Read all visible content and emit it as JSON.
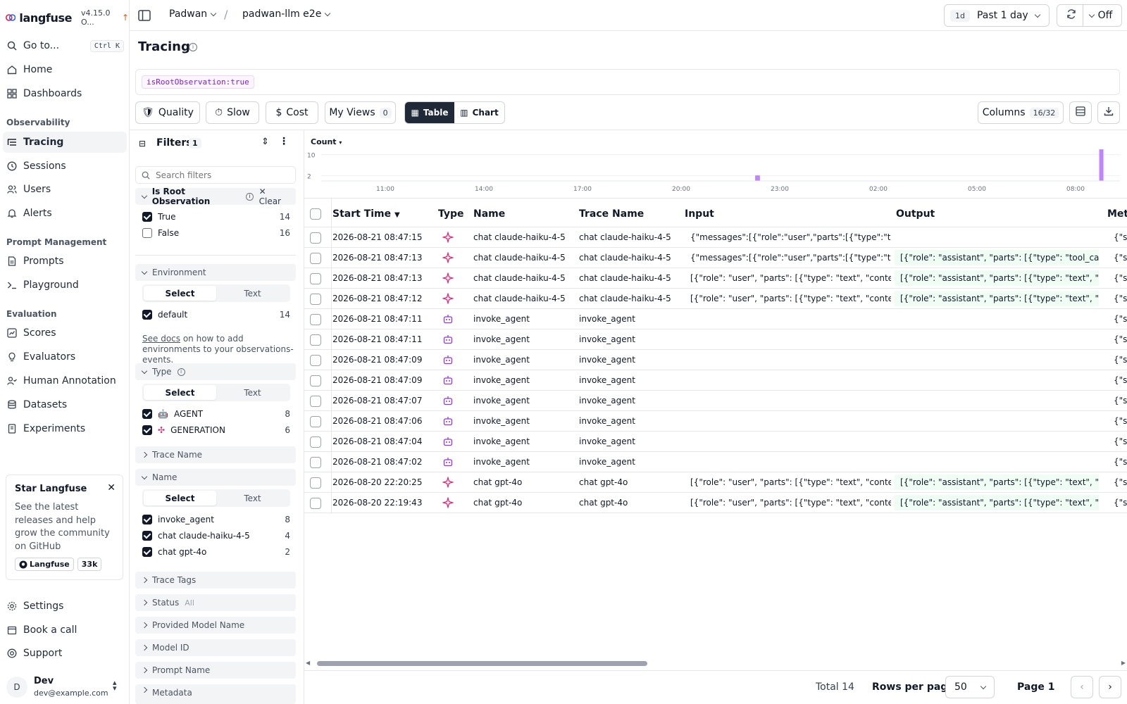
{
  "app": {
    "logo_text": "langfuse",
    "version": "v4.15.0 O..."
  },
  "sidebar": {
    "goto": {
      "label": "Go to...",
      "shortcut": "Ctrl K"
    },
    "home": "Home",
    "dashboards": "Dashboards",
    "sections": {
      "observability": "Observability",
      "prompt_management": "Prompt Management",
      "evaluation": "Evaluation"
    },
    "tracing": "Tracing",
    "sessions": "Sessions",
    "users": "Users",
    "alerts": "Alerts",
    "prompts": "Prompts",
    "playground": "Playground",
    "scores": "Scores",
    "evaluators": "Evaluators",
    "human_annotation": "Human Annotation",
    "datasets": "Datasets",
    "experiments": "Experiments",
    "star_card": {
      "title": "Star Langfuse",
      "description": "See the latest releases and help grow the community on GitHub",
      "github_label": "Langfuse",
      "stars": "33k"
    },
    "settings": "Settings",
    "book_call": "Book a call",
    "support": "Support",
    "user": {
      "initial": "D",
      "name": "Dev",
      "email": "dev@example.com"
    }
  },
  "topbar": {
    "org": "Padwan",
    "project": "padwan-llm e2e",
    "range_short": "1d",
    "range_label": "Past 1 day",
    "refresh": "Off"
  },
  "page": {
    "title": "Tracing",
    "query_chip": "isRootObservation:true"
  },
  "toolbar": {
    "quality": "Quality",
    "slow": "Slow",
    "cost": "Cost",
    "my_views": "My Views",
    "my_views_count": "0",
    "table": "Table",
    "chart": "Chart",
    "columns": "Columns",
    "columns_count": "16/32"
  },
  "filters": {
    "title": "Filters",
    "count": "1",
    "search_placeholder": "Search filters",
    "root": {
      "label": "Is Root Observation",
      "clear": "Clear",
      "options": [
        {
          "label": "True",
          "count": "14"
        },
        {
          "label": "False",
          "count": "16"
        }
      ]
    },
    "environment": {
      "label": "Environment",
      "select": "Select",
      "text": "Text",
      "options": [
        {
          "label": "default",
          "count": "14"
        }
      ],
      "docs_link": "See docs",
      "docs_text": " on how to add environments to your observations-events."
    },
    "type": {
      "label": "Type",
      "select": "Select",
      "text": "Text",
      "options": [
        {
          "label": "AGENT",
          "count": "8"
        },
        {
          "label": "GENERATION",
          "count": "6"
        }
      ]
    },
    "trace_name": "Trace Name",
    "name": {
      "label": "Name",
      "select": "Select",
      "text": "Text",
      "options": [
        {
          "label": "invoke_agent",
          "count": "8"
        },
        {
          "label": "chat claude-haiku-4-5",
          "count": "4"
        },
        {
          "label": "chat gpt-4o",
          "count": "2"
        }
      ]
    },
    "trace_tags": "Trace Tags",
    "status": "Status",
    "status_value": "All",
    "provided_model": "Provided Model Name",
    "model_id": "Model ID",
    "prompt_name": "Prompt Name",
    "metadata": "Metadata"
  },
  "chart_data": {
    "type": "bar",
    "metric_label": "Count",
    "y_ticks": [
      "10",
      "2"
    ],
    "x_ticks": [
      "11:00",
      "14:00",
      "17:00",
      "20:00",
      "23:00",
      "02:00",
      "05:00",
      "08:00"
    ],
    "x": [
      "22:19",
      "22:20",
      "08:47"
    ],
    "values": [
      1,
      1,
      12
    ],
    "bar_color": "#c084fc"
  },
  "table": {
    "headers": {
      "start_time": "Start Time",
      "type": "Type",
      "name": "Name",
      "trace_name": "Trace Name",
      "input": "Input",
      "output": "Output",
      "metadata": "Meta"
    },
    "rows": [
      {
        "time": "2026-08-21 08:47:15",
        "type": "GENERATION",
        "name": "chat claude-haiku-4-5",
        "trace": "chat claude-haiku-4-5",
        "input": "{\"messages\":[{\"role\":\"user\",\"parts\":[{\"type\":\"text\",\"...",
        "output": "",
        "meta": "{\"sc"
      },
      {
        "time": "2026-08-21 08:47:13",
        "type": "GENERATION",
        "name": "chat claude-haiku-4-5",
        "trace": "chat claude-haiku-4-5",
        "input": "{\"messages\":[{\"role\":\"user\",\"parts\":[{\"type\":\"text\",\"...",
        "output": "[{\"role\": \"assistant\", \"parts\": [{\"type\": \"tool_call\", \"id...",
        "meta": "{\"sc"
      },
      {
        "time": "2026-08-21 08:47:13",
        "type": "GENERATION",
        "name": "chat claude-haiku-4-5",
        "trace": "chat claude-haiku-4-5",
        "input": "[{\"role\": \"user\", \"parts\": [{\"type\": \"text\", \"content\": \"...",
        "output": "[{\"role\": \"assistant\", \"parts\": [{\"type\": \"text\", \"conte...",
        "meta": "{\"sc"
      },
      {
        "time": "2026-08-21 08:47:12",
        "type": "GENERATION",
        "name": "chat claude-haiku-4-5",
        "trace": "chat claude-haiku-4-5",
        "input": "[{\"role\": \"user\", \"parts\": [{\"type\": \"text\", \"content\": \"...",
        "output": "[{\"role\": \"assistant\", \"parts\": [{\"type\": \"text\", \"conte...",
        "meta": "{\"sc"
      },
      {
        "time": "2026-08-21 08:47:11",
        "type": "AGENT",
        "name": "invoke_agent",
        "trace": "invoke_agent",
        "input": "",
        "output": "",
        "meta": "{\"sc"
      },
      {
        "time": "2026-08-21 08:47:11",
        "type": "AGENT",
        "name": "invoke_agent",
        "trace": "invoke_agent",
        "input": "",
        "output": "",
        "meta": "{\"sc"
      },
      {
        "time": "2026-08-21 08:47:09",
        "type": "AGENT",
        "name": "invoke_agent",
        "trace": "invoke_agent",
        "input": "",
        "output": "",
        "meta": "{\"sc"
      },
      {
        "time": "2026-08-21 08:47:09",
        "type": "AGENT",
        "name": "invoke_agent",
        "trace": "invoke_agent",
        "input": "",
        "output": "",
        "meta": "{\"sc"
      },
      {
        "time": "2026-08-21 08:47:07",
        "type": "AGENT",
        "name": "invoke_agent",
        "trace": "invoke_agent",
        "input": "",
        "output": "",
        "meta": "{\"sc"
      },
      {
        "time": "2026-08-21 08:47:06",
        "type": "AGENT",
        "name": "invoke_agent",
        "trace": "invoke_agent",
        "input": "",
        "output": "",
        "meta": "{\"sc"
      },
      {
        "time": "2026-08-21 08:47:04",
        "type": "AGENT",
        "name": "invoke_agent",
        "trace": "invoke_agent",
        "input": "",
        "output": "",
        "meta": "{\"sc"
      },
      {
        "time": "2026-08-21 08:47:02",
        "type": "AGENT",
        "name": "invoke_agent",
        "trace": "invoke_agent",
        "input": "",
        "output": "",
        "meta": "{\"sc"
      },
      {
        "time": "2026-08-20 22:20:25",
        "type": "GENERATION",
        "name": "chat gpt-4o",
        "trace": "chat gpt-4o",
        "input": "[{\"role\": \"user\", \"parts\": [{\"type\": \"text\", \"content\": \"...",
        "output": "[{\"role\": \"assistant\", \"parts\": [{\"type\": \"text\", \"conte...",
        "meta": "{\"sc"
      },
      {
        "time": "2026-08-20 22:19:43",
        "type": "GENERATION",
        "name": "chat gpt-4o",
        "trace": "chat gpt-4o",
        "input": "[{\"role\": \"user\", \"parts\": [{\"type\": \"text\", \"content\": \"...",
        "output": "[{\"role\": \"assistant\", \"parts\": [{\"type\": \"text\", \"conte...",
        "meta": "{\"sc"
      }
    ]
  },
  "footer": {
    "total": "Total 14",
    "rows_per_page_label": "Rows per page",
    "rows_per_page": "50",
    "page": "Page 1"
  }
}
